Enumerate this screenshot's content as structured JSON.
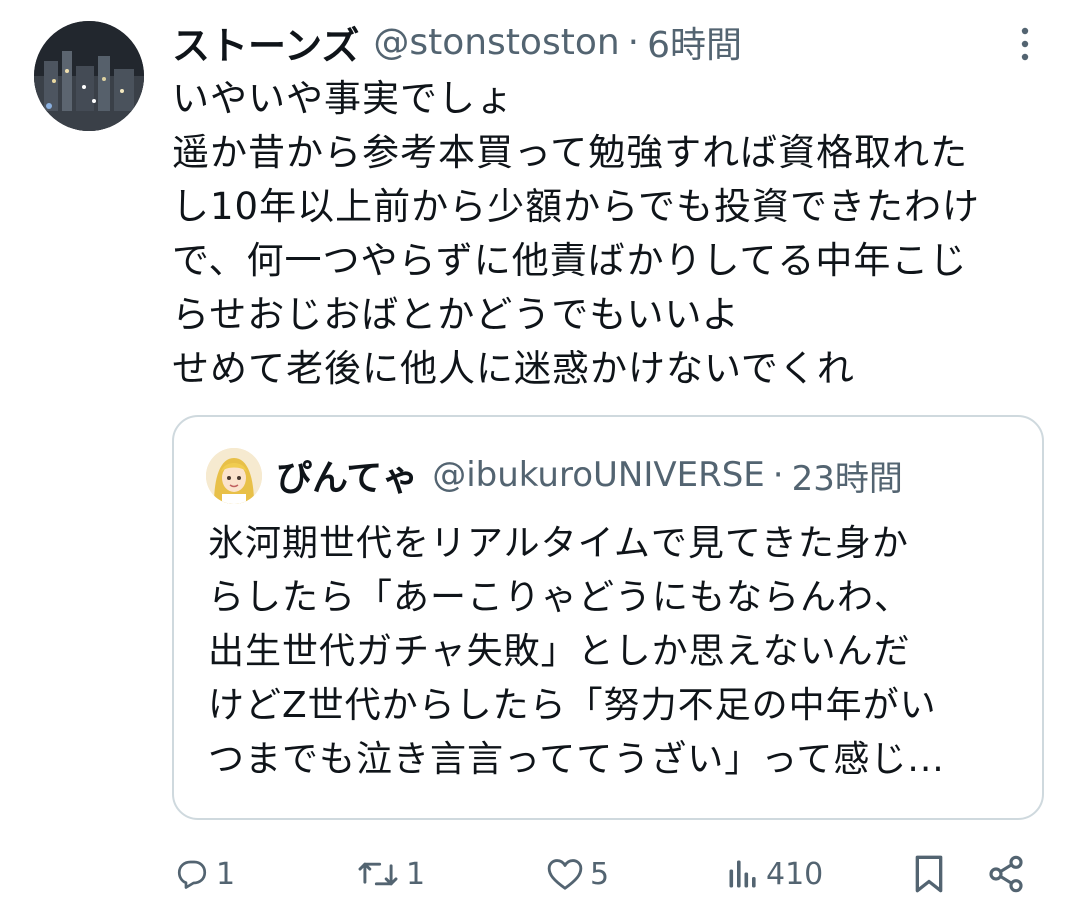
{
  "tweet": {
    "author_name": "ストーンズ",
    "handle": "@stonstoston",
    "separator": "·",
    "time": "6時間",
    "text_lines": [
      "いやいや事実でしょ",
      "遥か昔から参考本買って勉強すれば資格取れた",
      "し10年以上前から少額からでも投資できたわけ",
      "で、何一つやらずに他責ばかりしてる中年こじ",
      "らせおじおばとかどうでもいいよ",
      "せめて老後に他人に迷惑かけないでくれ"
    ],
    "more_icon": "more-vertical-icon"
  },
  "quote": {
    "author_name": "ぴんてゃ",
    "handle": "@ibukuroUNIVERSE",
    "separator": "·",
    "time": "23時間",
    "text_lines": [
      "氷河期世代をリアルタイムで見てきた身か",
      "らしたら「あーこりゃどうにもならんわ、",
      "出生世代ガチャ失敗」としか思えないんだ",
      "けどZ世代からしたら「努力不足の中年がい",
      "つまでも泣き言言っててうざい」って感じ..."
    ]
  },
  "actions": {
    "reply_count": "1",
    "retweet_count": "1",
    "like_count": "5",
    "views_count": "410",
    "icons": [
      "reply-icon",
      "retweet-icon",
      "like-icon",
      "views-icon",
      "bookmark-icon",
      "share-icon"
    ]
  },
  "colors": {
    "text": "#0f1419",
    "secondary": "#536471",
    "border": "#cfd9de"
  }
}
